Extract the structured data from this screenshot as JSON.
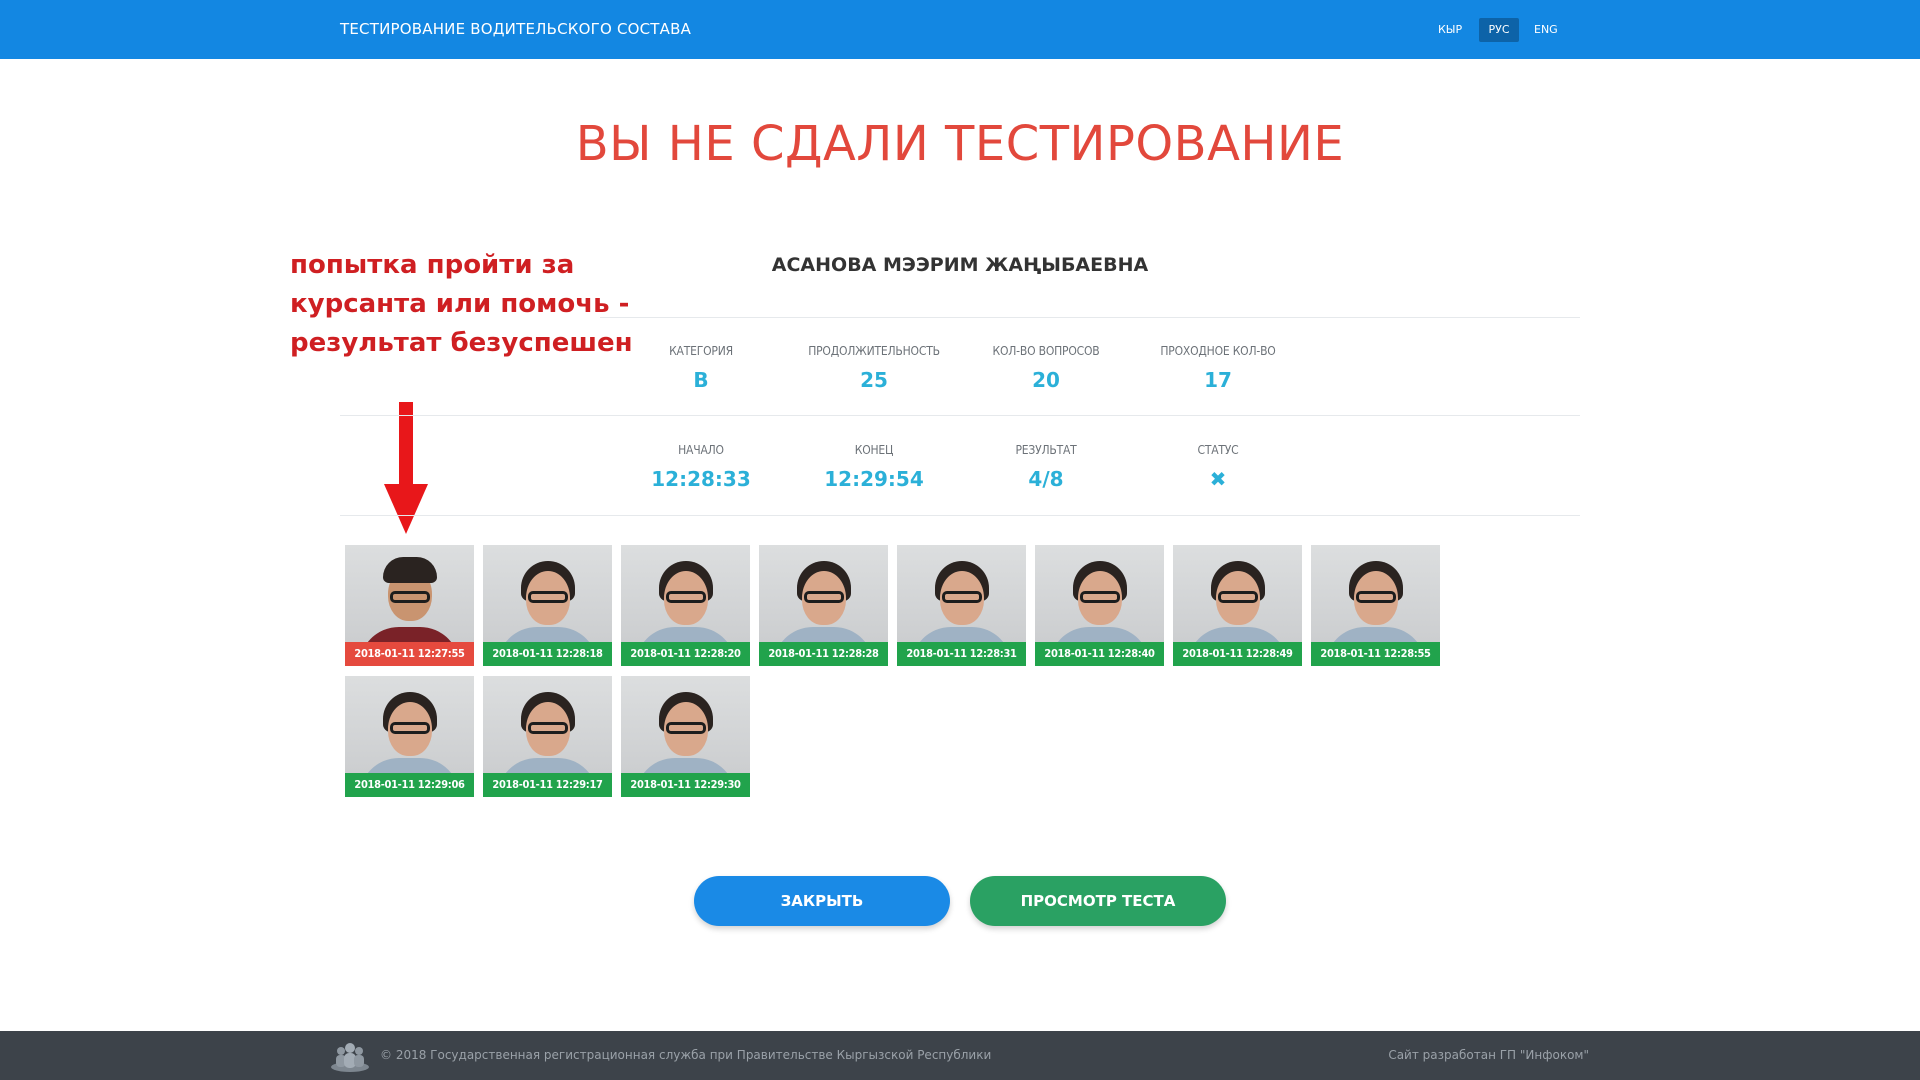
{
  "header": {
    "title": "ТЕСТИРОВАНИЕ ВОДИТЕЛЬСКОГО СОСТАВА",
    "languages": [
      {
        "label": "КЫР",
        "active": false
      },
      {
        "label": "РУС",
        "active": true
      },
      {
        "label": "ENG",
        "active": false
      }
    ]
  },
  "result_title": "ВЫ НЕ СДАЛИ ТЕСТИРОВАНИЕ",
  "annotation": {
    "lines": [
      "попытка пройти за",
      "курсанта или помочь -",
      "результат безуспешен"
    ],
    "color": "#cf1f22"
  },
  "person_name": "АСАНОВА МЭЭРИМ ЖАҢЫБАЕВНА",
  "stats_row1": [
    {
      "label": "КАТЕГОРИЯ",
      "value": "B"
    },
    {
      "label": "ПРОДОЛЖИТЕЛЬНОСТЬ",
      "value": "25"
    },
    {
      "label": "КОЛ-ВО ВОПРОСОВ",
      "value": "20"
    },
    {
      "label": "ПРОХОДНОЕ КОЛ-ВО",
      "value": "17"
    }
  ],
  "stats_row2": [
    {
      "label": "НАЧАЛО",
      "value": "12:28:33"
    },
    {
      "label": "КОНЕЦ",
      "value": "12:29:54"
    },
    {
      "label": "РЕЗУЛЬТАТ",
      "value": "4/8"
    },
    {
      "label": "СТАТУС",
      "value": "✖"
    }
  ],
  "photos": [
    {
      "timestamp": "2018-01-11 12:27:55",
      "status": "mismatch"
    },
    {
      "timestamp": "2018-01-11 12:28:18",
      "status": "match"
    },
    {
      "timestamp": "2018-01-11 12:28:20",
      "status": "match"
    },
    {
      "timestamp": "2018-01-11 12:28:28",
      "status": "match"
    },
    {
      "timestamp": "2018-01-11 12:28:31",
      "status": "match"
    },
    {
      "timestamp": "2018-01-11 12:28:40",
      "status": "match"
    },
    {
      "timestamp": "2018-01-11 12:28:49",
      "status": "match"
    },
    {
      "timestamp": "2018-01-11 12:28:55",
      "status": "match"
    },
    {
      "timestamp": "2018-01-11 12:29:06",
      "status": "match"
    },
    {
      "timestamp": "2018-01-11 12:29:17",
      "status": "match"
    },
    {
      "timestamp": "2018-01-11 12:29:30",
      "status": "match"
    }
  ],
  "buttons": {
    "close_label": "ЗАКРЫТЬ",
    "view_label": "ПРОСМОТР ТЕСТА"
  },
  "footer": {
    "copyright": "© 2018 Государственная регистрационная служба при Правительстве Кыргызской Республики",
    "developer": "Сайт разработан ГП \"Инфоком\""
  },
  "colors": {
    "header": "#1387e2",
    "fail_title": "#e2483c",
    "value": "#2bb0d8",
    "match_stamp": "#21a34c",
    "mismatch_stamp": "#e54a3e",
    "close_button": "#1a8ae6",
    "view_button": "#2aa163",
    "footer": "#3d434a"
  }
}
